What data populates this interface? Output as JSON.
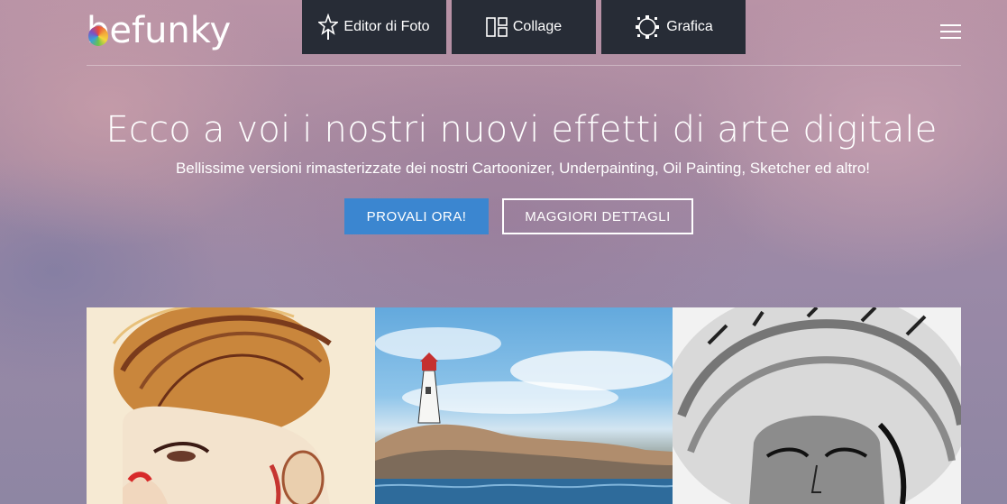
{
  "header": {
    "logo_text": "befunky",
    "nav": [
      {
        "label": "Editor di Foto",
        "icon": "star-icon"
      },
      {
        "label": "Collage",
        "icon": "collage-icon"
      },
      {
        "label": "Grafica",
        "icon": "graphic-icon"
      }
    ],
    "menu_icon": "hamburger-menu-icon"
  },
  "hero": {
    "title": "Ecco a voi i nostri nuovi effetti di arte digitale",
    "subtitle": "Bellissime versioni rimasterizzate dei nostri Cartoonizer, Underpainting, Oil Painting, Sketcher ed altro!",
    "primary_button": "PROVALI ORA!",
    "secondary_button": "MAGGIORI DETTAGLI"
  },
  "colors": {
    "nav_bg": "#272c36",
    "primary_button": "#3b86d0",
    "text": "#ffffff"
  }
}
